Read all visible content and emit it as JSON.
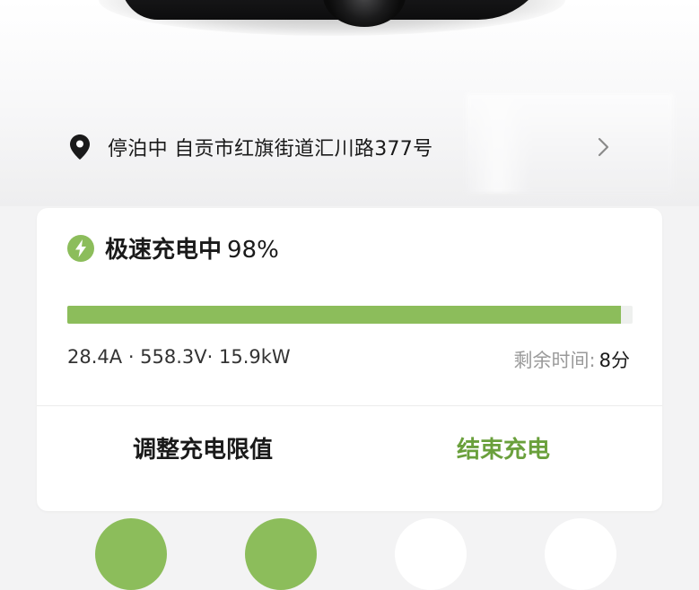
{
  "location": {
    "status": "停泊中",
    "address": "自贡市红旗街道汇川路377号"
  },
  "charging": {
    "mode": "极速充电中",
    "percent_label": "98%",
    "progress_percent": 98,
    "current": "28.4A",
    "voltage": "558.3V",
    "power": "15.9kW",
    "remaining_label": "剩余时间:",
    "remaining_value": "8分"
  },
  "actions": {
    "adjust_limit_label": "调整充电限值",
    "end_charge_label": "结束充电"
  },
  "colors": {
    "accent_green": "#8cbd5b",
    "end_button_text": "#6aa03c",
    "background": "#f3f3f4"
  },
  "icons": {
    "location": "map-pin-icon",
    "chevron": "chevron-right-icon",
    "charging": "lightning-bolt-icon"
  }
}
